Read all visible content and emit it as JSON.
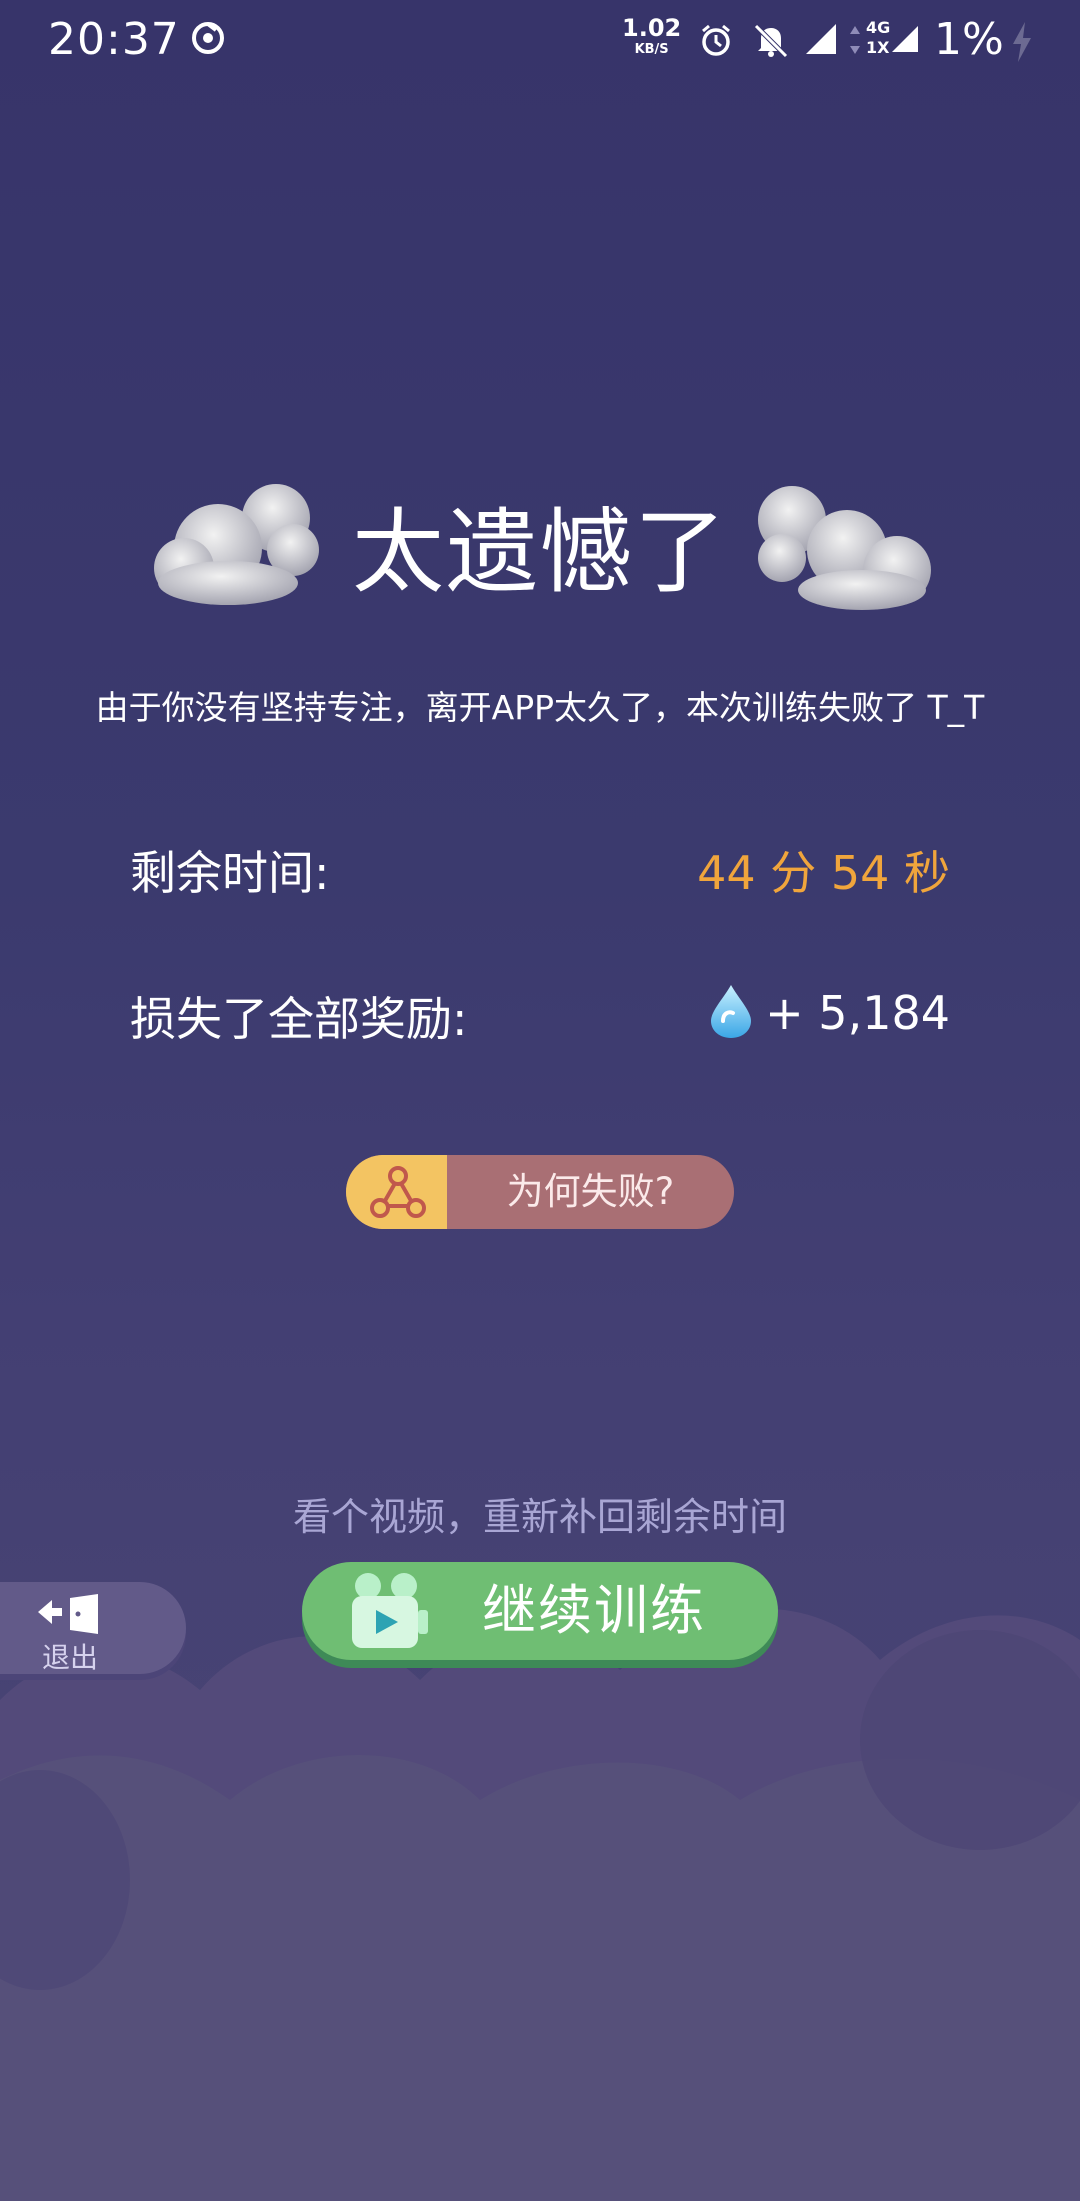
{
  "status_bar": {
    "time": "20:37",
    "net_speed_value": "1.02",
    "net_speed_unit": "KB/S",
    "network_type_top": "4G",
    "network_type_bottom": "1X",
    "battery_percent": "1%"
  },
  "result": {
    "title": "太遗憾了",
    "message": "由于你没有坚持专注，离开APP太久了，本次训练失败了 T_T"
  },
  "stats": {
    "remaining_label": "剩余时间:",
    "remaining_value": "44 分 54 秒",
    "lost_label": "损失了全部奖励:",
    "lost_value": "+ 5,184"
  },
  "buttons": {
    "why_fail": "为何失败?",
    "hint": "看个视频，重新补回剩余时间",
    "continue": "继续训练",
    "exit": "退出"
  },
  "colors": {
    "background": "#3b3a6e",
    "accent_orange": "#f0a53c",
    "continue_green": "#6fbe73",
    "why_button": "#a96f74"
  },
  "icons": [
    "app-notification-icon",
    "alarm-icon",
    "mute-icon",
    "signal-icon",
    "battery-charging-icon",
    "cloud-icon",
    "water-drop-icon",
    "nodes-icon",
    "video-camera-icon",
    "exit-door-icon"
  ]
}
